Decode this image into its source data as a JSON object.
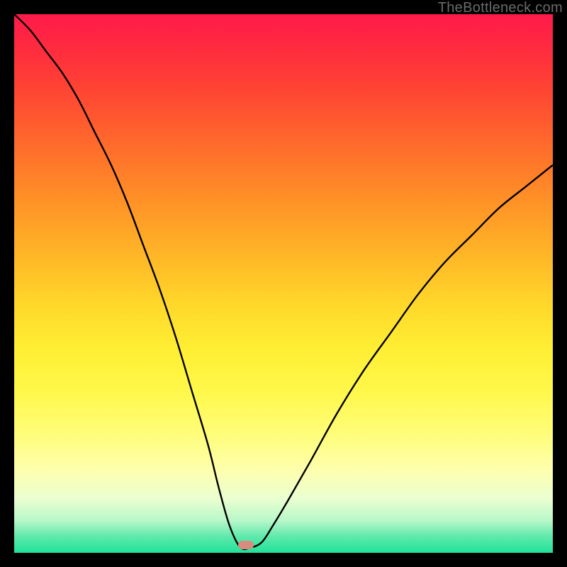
{
  "watermark": {
    "text": "TheBottleneck.com"
  },
  "marker": {
    "color": "#d88b7e",
    "x_pct": 0.43,
    "y_pct": 0.985
  },
  "colors": {
    "curve_stroke": "#000000",
    "background_frame": "#000000"
  },
  "chart_data": {
    "type": "line",
    "title": "",
    "xlabel": "",
    "ylabel": "",
    "xlim": [
      0,
      1
    ],
    "ylim": [
      0,
      1
    ],
    "grid": false,
    "legend": false,
    "note": "Axes are unlabeled in the image; x and y are normalized 0–1 fractions of the plot area. y=0 is bottom (green), y=1 is top (red). Curve values are read off the image at regular x samples.",
    "series": [
      {
        "name": "bottleneck-curve",
        "x": [
          0.0,
          0.03,
          0.06,
          0.09,
          0.12,
          0.15,
          0.18,
          0.21,
          0.24,
          0.27,
          0.3,
          0.33,
          0.36,
          0.38,
          0.4,
          0.42,
          0.44,
          0.46,
          0.48,
          0.51,
          0.55,
          0.6,
          0.65,
          0.7,
          0.75,
          0.8,
          0.85,
          0.9,
          0.95,
          1.0
        ],
        "y": [
          1.0,
          0.97,
          0.93,
          0.89,
          0.84,
          0.78,
          0.72,
          0.65,
          0.57,
          0.49,
          0.4,
          0.3,
          0.2,
          0.12,
          0.05,
          0.01,
          0.01,
          0.02,
          0.05,
          0.1,
          0.17,
          0.26,
          0.34,
          0.41,
          0.48,
          0.54,
          0.59,
          0.64,
          0.68,
          0.72
        ]
      }
    ],
    "background_gradient": {
      "direction": "vertical",
      "stops": [
        {
          "pos": 0.0,
          "color": "#ff1a4b"
        },
        {
          "pos": 0.14,
          "color": "#ff4433"
        },
        {
          "pos": 0.34,
          "color": "#ff8f27"
        },
        {
          "pos": 0.54,
          "color": "#ffd82a"
        },
        {
          "pos": 0.78,
          "color": "#fffd7a"
        },
        {
          "pos": 0.9,
          "color": "#eaffd1"
        },
        {
          "pos": 1.0,
          "color": "#1fe29a"
        }
      ]
    },
    "marker_point": {
      "x": 0.43,
      "y": 0.015
    }
  }
}
